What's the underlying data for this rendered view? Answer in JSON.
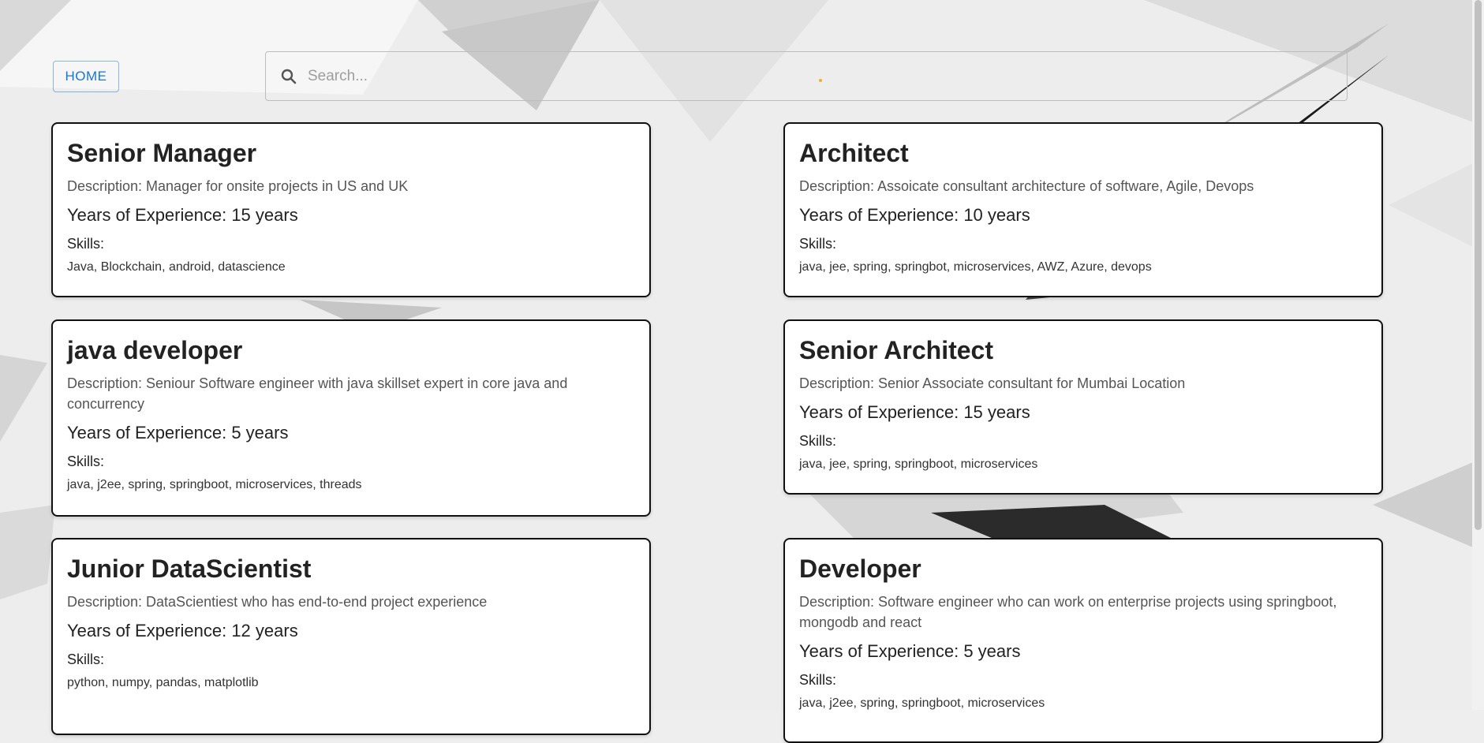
{
  "nav": {
    "home_label": "HOME"
  },
  "search": {
    "placeholder": "Search...",
    "value": ""
  },
  "jobs": [
    {
      "title": "Senior Manager",
      "description": "Description: Manager for onsite projects in US and UK",
      "experience": "Years of Experience: 15 years",
      "skills_label": "Skills:",
      "skills": "Java, Blockchain, android, datascience"
    },
    {
      "title": "Architect",
      "description": "Description: Assoicate consultant architecture of software, Agile, Devops",
      "experience": "Years of Experience: 10 years",
      "skills_label": "Skills:",
      "skills": "java, jee, spring, springbot, microservices, AWZ, Azure, devops"
    },
    {
      "title": "java developer",
      "description": "Description: Seniour Software engineer with java skillset expert in core java and concurrency",
      "experience": "Years of Experience: 5 years",
      "skills_label": "Skills:",
      "skills": "java, j2ee, spring, springboot, microservices, threads"
    },
    {
      "title": "Senior Architect",
      "description": "Description: Senior Associate consultant for Mumbai Location",
      "experience": "Years of Experience: 15 years",
      "skills_label": "Skills:",
      "skills": "java, jee, spring, springboot, microservices"
    },
    {
      "title": "Junior DataScientist",
      "description": "Description: DataScientiest who has end-to-end project experience",
      "experience": "Years of Experience: 12 years",
      "skills_label": "Skills:",
      "skills": "python, numpy, pandas, matplotlib"
    },
    {
      "title": "Developer",
      "description": "Description: Software engineer who can work on enterprise projects using springboot, mongodb and react",
      "experience": "Years of Experience: 5 years",
      "skills_label": "Skills:",
      "skills": "java, j2ee, spring, springboot, microservices"
    }
  ],
  "colors": {
    "accent": "#1976d2",
    "card_border": "#111111",
    "indicator": "#f2b01e"
  },
  "icons": {
    "search": "search-icon"
  }
}
